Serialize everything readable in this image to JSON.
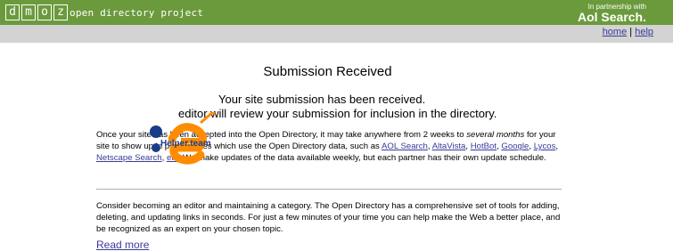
{
  "header": {
    "logo_letters": [
      "d",
      "m",
      "o",
      "z"
    ],
    "project": "open directory project",
    "partner_prefix": "In partnership with",
    "partner_name": "Aol Search."
  },
  "nav": {
    "home": "home",
    "sep": "|",
    "help": "help"
  },
  "main": {
    "title": "Submission Received",
    "line1": "Your site submission has been received.",
    "line2": "editor will review your submission for inclusion in the directory.",
    "p1_text_a": "Once your site has been accepted into the Open Directory, it may take anywhere from 2 weeks to ",
    "p1_em": "several months",
    "p1_text_b": " for your site to show up in partner sites which use the Open Directory data, such as ",
    "partners": [
      "AOL Search",
      "AltaVista",
      "HotBot",
      "Google",
      "Lycos",
      "Netscape Search",
      "etc."
    ],
    "p1_text_c": " We make updates of the data available weekly, but each partner has their own update schedule.",
    "p2_text": "Consider becoming an editor and maintaining a category. The Open Directory has a comprehensive set of tools for adding, deleting, and updating links in seconds. For just a few minutes of your time you can help make the Web a better place, and be recognized as an expert on your chosen topic.",
    "read_more": "Read more"
  },
  "watermark": {
    "text": "Helper.team",
    "colors": {
      "e": "#ff8c00",
      "dot": "#1a3d8a"
    }
  },
  "colors": {
    "topbar": "#6b9a3c",
    "navbar": "#d3d3d3",
    "link": "#3a3a9a"
  }
}
